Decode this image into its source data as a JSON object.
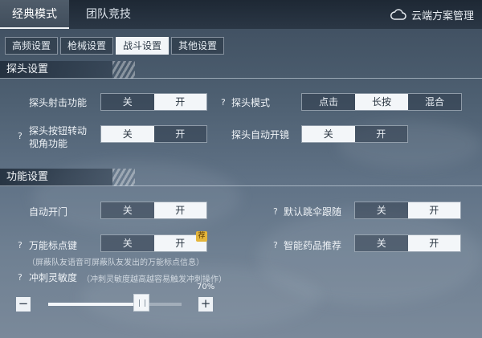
{
  "top_tabs": [
    {
      "label": "经典模式",
      "active": true
    },
    {
      "label": "团队竞技",
      "active": false
    }
  ],
  "cloud_mgmt": {
    "icon": "cloud-icon",
    "label": "云端方案管理"
  },
  "sub_tabs": [
    {
      "label": "高频设置",
      "active": false
    },
    {
      "label": "枪械设置",
      "active": false
    },
    {
      "label": "战斗设置",
      "active": true
    },
    {
      "label": "其他设置",
      "active": false
    }
  ],
  "sections": {
    "peek": {
      "title": "探头设置",
      "peek_fire": {
        "label": "探头射击功能",
        "options": [
          "关",
          "开"
        ],
        "selected": "开"
      },
      "peek_mode": {
        "label": "探头模式",
        "options": [
          "点击",
          "长按",
          "混合"
        ],
        "selected": "长按"
      },
      "peek_turn": {
        "label_line1": "探头按钮转动",
        "label_line2": "视角功能",
        "options": [
          "关",
          "开"
        ],
        "selected": "关"
      },
      "peek_scope": {
        "label": "探头自动开镜",
        "options": [
          "关",
          "开"
        ],
        "selected": "关"
      }
    },
    "function": {
      "title": "功能设置",
      "auto_door": {
        "label": "自动开门",
        "options": [
          "关",
          "开"
        ],
        "selected": "开"
      },
      "parachute": {
        "label": "默认跳伞跟随",
        "options": [
          "关",
          "开"
        ],
        "selected": "开"
      },
      "universal_mark": {
        "label": "万能标点键",
        "options": [
          "关",
          "开"
        ],
        "selected": "开",
        "badge": "荐",
        "hint": "（屏蔽队友语音可屏蔽队友发出的万能标点信息）"
      },
      "smart_medicine": {
        "label": "智能药品推荐",
        "options": [
          "关",
          "开"
        ],
        "selected": "开"
      },
      "sprint_sensitivity": {
        "label": "冲刺灵敏度",
        "hint": "（冲刺灵敏度越高越容易触发冲刺操作）",
        "value": 70,
        "value_text": "70%",
        "minus": "−",
        "plus": "+"
      }
    }
  },
  "help_mark": "?",
  "colors": {
    "active_bg": "#f3f6f9",
    "badge": "#e4b53a"
  }
}
